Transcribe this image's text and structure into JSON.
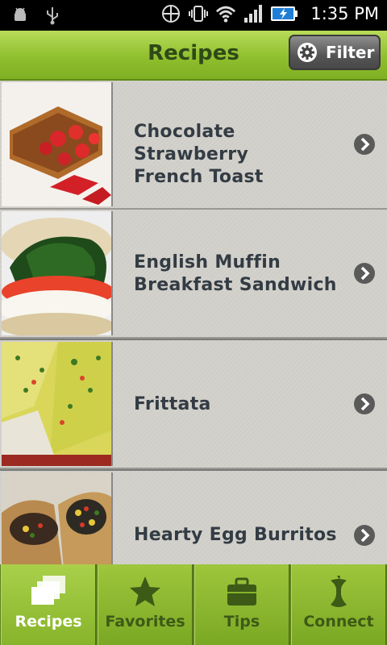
{
  "status_bar": {
    "time": "1:35 PM"
  },
  "header": {
    "title": "Recipes",
    "filter_label": "Filter"
  },
  "recipes": [
    {
      "title_line1": "Chocolate Strawberry",
      "title_line2": "French Toast"
    },
    {
      "title_line1": "English Muffin",
      "title_line2": "Breakfast Sandwich"
    },
    {
      "title_line1": "Frittata",
      "title_line2": ""
    },
    {
      "title_line1": "Hearty Egg Burritos",
      "title_line2": ""
    }
  ],
  "tabs": [
    {
      "label": "Recipes",
      "icon": "recipes-icon",
      "active": true
    },
    {
      "label": "Favorites",
      "icon": "star-icon",
      "active": false
    },
    {
      "label": "Tips",
      "icon": "briefcase-icon",
      "active": false
    },
    {
      "label": "Connect",
      "icon": "apple-core-icon",
      "active": false
    }
  ],
  "colors": {
    "accent_green": "#8fbf2e",
    "title_text": "#2f4a18",
    "row_text": "#333c44"
  }
}
